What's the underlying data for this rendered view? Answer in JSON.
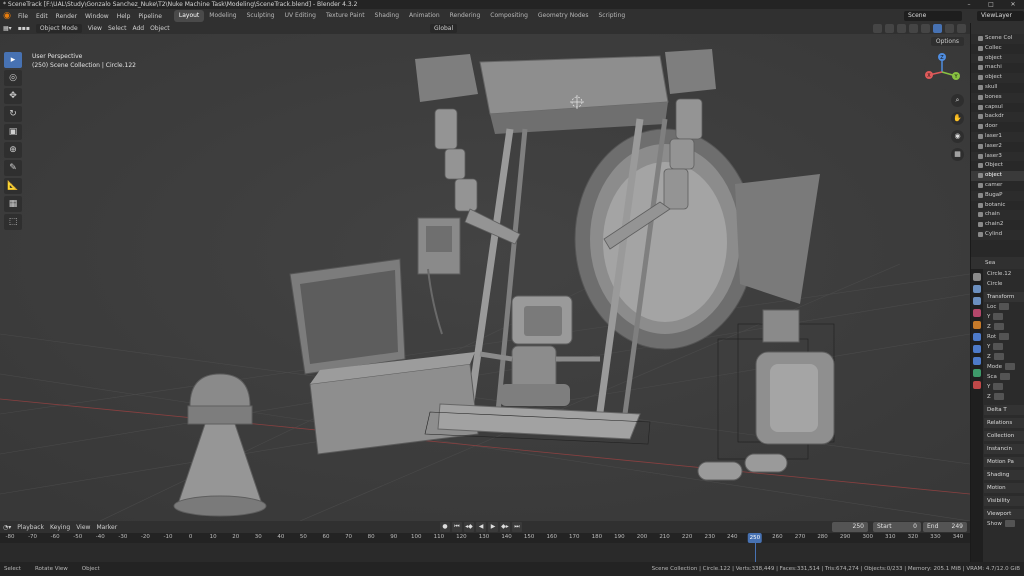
{
  "title": "* SceneTrack [F:\\UAL\\Study\\Gonzalo Sanchez_Nuke\\T2\\Nuke Machine Task\\Modeling\\SceneTrack.blend] - Blender 4.3.2",
  "menu": [
    "File",
    "Edit",
    "Render",
    "Window",
    "Help",
    "Pipeline"
  ],
  "workspaces": [
    "Layout",
    "Modeling",
    "Sculpting",
    "UV Editing",
    "Texture Paint",
    "Shading",
    "Animation",
    "Rendering",
    "Compositing",
    "Geometry Nodes",
    "Scripting"
  ],
  "active_workspace": "Layout",
  "scene_name": "Scene",
  "view_layer": "ViewLayer",
  "viewport_header": {
    "mode": "Object Mode",
    "menus": [
      "View",
      "Select",
      "Add",
      "Object"
    ],
    "orientation": "Global",
    "options": "Options"
  },
  "viewport_info": {
    "perspective": "User Perspective",
    "collection": "(250) Scene Collection | Circle.122"
  },
  "gizmo": {
    "x": "X",
    "y": "Y",
    "z": "Z"
  },
  "timeline": {
    "menus": [
      "Playback",
      "Keying",
      "View",
      "Marker"
    ],
    "current_frame": "250",
    "start_label": "Start",
    "start": "0",
    "end_label": "End",
    "end": "249",
    "ticks": [
      "-80",
      "-70",
      "-60",
      "-50",
      "-40",
      "-30",
      "-20",
      "-10",
      "0",
      "10",
      "20",
      "30",
      "40",
      "50",
      "60",
      "70",
      "80",
      "90",
      "100",
      "110",
      "120",
      "130",
      "140",
      "150",
      "160",
      "170",
      "180",
      "190",
      "200",
      "210",
      "220",
      "230",
      "240",
      "250",
      "260",
      "270",
      "280",
      "290",
      "300",
      "310",
      "320",
      "330",
      "340"
    ]
  },
  "statusbar": {
    "left": [
      "Select",
      "Rotate View",
      "Object"
    ],
    "stats": "Scene Collection | Circle.122 | Verts:338,449 | Faces:331,514 | Tris:674,274 | Objects:0/233 | Memory: 205.1 MiB | VRAM: 4.7/12.0 GiB"
  },
  "outliner": {
    "items": [
      "Scene Col",
      "Collec",
      "object",
      "machi",
      "object",
      "skull",
      "bones",
      "capsul",
      "backdr",
      "door",
      "laser1",
      "laser2",
      "laser3",
      "Object",
      "object",
      "camer",
      "BugaP",
      "botanic",
      "chain",
      "chain2",
      "Cylind"
    ]
  },
  "properties": {
    "search": "Sea",
    "object_name": "Circle.12",
    "data_name": "Circle",
    "rows": [
      "Transform",
      "Loc",
      "Y",
      "Z",
      "Rot",
      "Y",
      "Z",
      "Mode",
      "Sca",
      "Y",
      "Z",
      "Delta T",
      "Relations",
      "Collection",
      "Instancin",
      "Motion Pa",
      "Shading",
      "Motion",
      "Visibility",
      "Viewport",
      "Show"
    ]
  },
  "tools": [
    "select-box",
    "cursor",
    "move",
    "rotate",
    "scale",
    "transform",
    "annotate",
    "measure",
    "add-cube",
    "add-primitive"
  ],
  "tool_glyphs": [
    "▸",
    "◎",
    "✥",
    "↻",
    "▣",
    "⊕",
    "✎",
    "📐",
    "▦",
    "⬚"
  ]
}
